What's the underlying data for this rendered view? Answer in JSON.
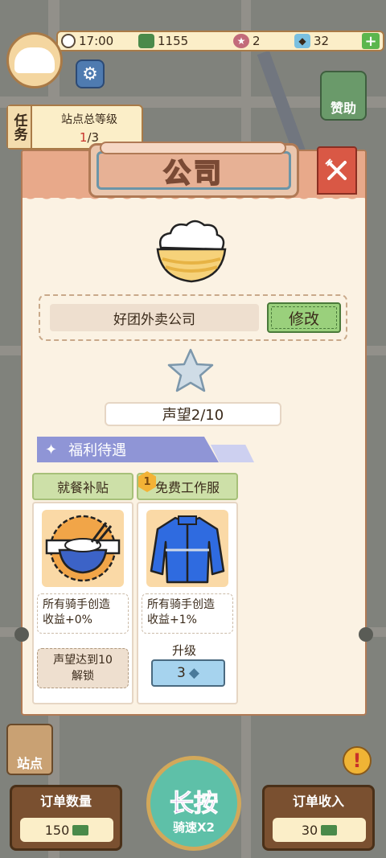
{
  "status_bar": {
    "time": "17:00",
    "cash": "1155",
    "reputation": "2",
    "gems": "32",
    "plus_label": "+"
  },
  "sponsor_label": "赞助",
  "task": {
    "tag": "任务",
    "title": "站点总等级",
    "progress_current": "1",
    "progress_total": "/3"
  },
  "station_label": "站点",
  "alert_glyph": "!",
  "bottom": {
    "orders_title": "订单数量",
    "orders_value": "150",
    "income_title": "订单收入",
    "income_value": "30",
    "hold_main": "长按",
    "hold_sub": "骑速X2"
  },
  "modal": {
    "title": "公司",
    "company_name": "好团外卖公司",
    "edit_label": "修改",
    "reputation": "声望2/10",
    "welfare_title": "福利待遇",
    "cards": [
      {
        "title": "就餐补贴",
        "desc_line1": "所有骑手创造",
        "desc_line2": "收益+0%",
        "lock_line1": "声望达到10",
        "lock_line2": "解锁"
      },
      {
        "title": "免费工作服",
        "badge": "1",
        "desc_line1": "所有骑手创造",
        "desc_line2": "收益+1%",
        "upgrade_label": "升级",
        "upgrade_cost": "3"
      }
    ]
  },
  "colors": {
    "header": "#e8a98a",
    "panel": "#fbf2e3",
    "accent_green": "#9ad07c",
    "welfare": "#8f95d6",
    "close": "#d95845"
  }
}
